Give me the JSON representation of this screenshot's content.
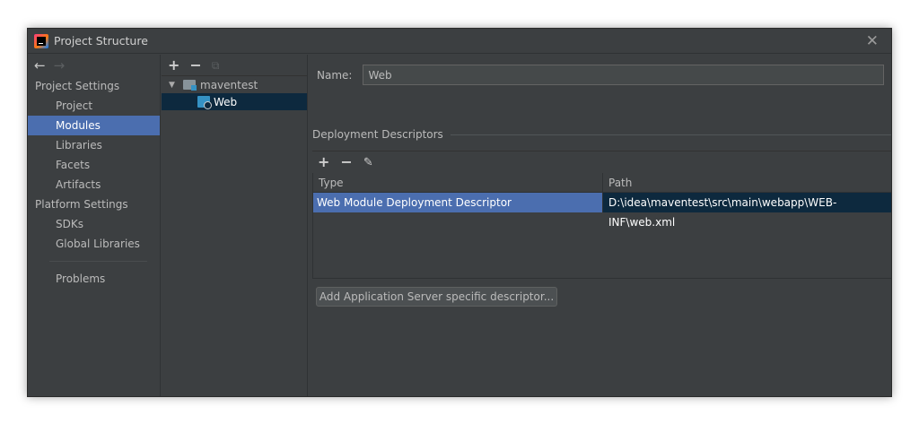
{
  "window": {
    "title": "Project Structure",
    "close_glyph": "✕"
  },
  "nav": {
    "back": "←",
    "forward": "→"
  },
  "sidebar": {
    "project_settings_label": "Project Settings",
    "project_settings_items": [
      "Project",
      "Modules",
      "Libraries",
      "Facets",
      "Artifacts"
    ],
    "platform_settings_label": "Platform Settings",
    "platform_settings_items": [
      "SDKs",
      "Global Libraries"
    ],
    "problems_label": "Problems",
    "selected": "Modules"
  },
  "tree": {
    "toolbar": {
      "add": "+",
      "remove": "−",
      "copy": "⧉"
    },
    "root": {
      "label": "maventest",
      "expanded": true
    },
    "child": {
      "label": "Web",
      "selected": true
    }
  },
  "main": {
    "name_label": "Name:",
    "name_value": "Web",
    "deployment_section_title": "Deployment Descriptors",
    "dd_toolbar": {
      "add": "+",
      "remove": "−",
      "edit": "✎"
    },
    "table": {
      "headers": [
        "Type",
        "Path"
      ],
      "rows": [
        {
          "type": "Web Module Deployment Descriptor",
          "path": "D:\\idea\\maventest\\src\\main\\webapp\\WEB-INF\\web.xml"
        }
      ]
    },
    "add_server_descriptor_button": "Add Application Server specific descriptor..."
  },
  "colors": {
    "background": "#3c3f41",
    "selection": "#4b6eaf",
    "selection_inactive": "#0d293e",
    "text": "#bbbbbb"
  }
}
